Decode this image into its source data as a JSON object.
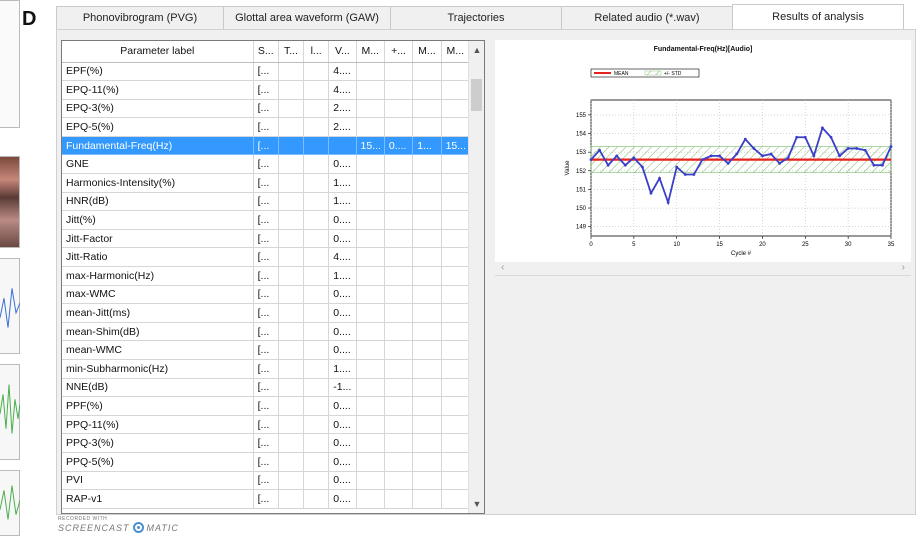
{
  "panel_label": "D",
  "tabs": [
    {
      "label": "Phonovibrogram (PVG)",
      "active": false
    },
    {
      "label": "Glottal area waveform (GAW)",
      "active": false
    },
    {
      "label": "Trajectories",
      "active": false
    },
    {
      "label": "Related audio (*.wav)",
      "active": false
    },
    {
      "label": "Results of analysis",
      "active": true
    }
  ],
  "table": {
    "columns": [
      "Parameter label",
      "S...",
      "T...",
      "l...",
      "V...",
      "M...",
      "+...",
      "M...",
      "M..."
    ],
    "rows": [
      [
        "EPF(%)",
        "[...",
        "",
        "",
        "4....",
        "",
        "",
        "",
        ""
      ],
      [
        "EPQ-11(%)",
        "[...",
        "",
        "",
        "4....",
        "",
        "",
        "",
        ""
      ],
      [
        "EPQ-3(%)",
        "[...",
        "",
        "",
        "2....",
        "",
        "",
        "",
        ""
      ],
      [
        "EPQ-5(%)",
        "[...",
        "",
        "",
        "2....",
        "",
        "",
        "",
        ""
      ],
      [
        "Fundamental-Freq(Hz)",
        "[...",
        "",
        "",
        "",
        "15...",
        "0....",
        "1...",
        "15..."
      ],
      [
        "GNE",
        "[...",
        "",
        "",
        "0....",
        "",
        "",
        "",
        ""
      ],
      [
        "Harmonics-Intensity(%)",
        "[...",
        "",
        "",
        "1....",
        "",
        "",
        "",
        ""
      ],
      [
        "HNR(dB)",
        "[...",
        "",
        "",
        "1....",
        "",
        "",
        "",
        ""
      ],
      [
        "Jitt(%)",
        "[...",
        "",
        "",
        "0....",
        "",
        "",
        "",
        ""
      ],
      [
        "Jitt-Factor",
        "[...",
        "",
        "",
        "0....",
        "",
        "",
        "",
        ""
      ],
      [
        "Jitt-Ratio",
        "[...",
        "",
        "",
        "4....",
        "",
        "",
        "",
        ""
      ],
      [
        "max-Harmonic(Hz)",
        "[...",
        "",
        "",
        "1....",
        "",
        "",
        "",
        ""
      ],
      [
        "max-WMC",
        "[...",
        "",
        "",
        "0....",
        "",
        "",
        "",
        ""
      ],
      [
        "mean-Jitt(ms)",
        "[...",
        "",
        "",
        "0....",
        "",
        "",
        "",
        ""
      ],
      [
        "mean-Shim(dB)",
        "[...",
        "",
        "",
        "0....",
        "",
        "",
        "",
        ""
      ],
      [
        "mean-WMC",
        "[...",
        "",
        "",
        "0....",
        "",
        "",
        "",
        ""
      ],
      [
        "min-Subharmonic(Hz)",
        "[...",
        "",
        "",
        "1....",
        "",
        "",
        "",
        ""
      ],
      [
        "NNE(dB)",
        "[...",
        "",
        "",
        "-1...",
        "",
        "",
        "",
        ""
      ],
      [
        "PPF(%)",
        "[...",
        "",
        "",
        "0....",
        "",
        "",
        "",
        ""
      ],
      [
        "PPQ-11(%)",
        "[...",
        "",
        "",
        "0....",
        "",
        "",
        "",
        ""
      ],
      [
        "PPQ-3(%)",
        "[...",
        "",
        "",
        "0....",
        "",
        "",
        "",
        ""
      ],
      [
        "PPQ-5(%)",
        "[...",
        "",
        "",
        "0....",
        "",
        "",
        "",
        ""
      ],
      [
        "PVI",
        "[...",
        "",
        "",
        "0....",
        "",
        "",
        "",
        ""
      ],
      [
        "RAP-v1",
        "[...",
        "",
        "",
        "0....",
        "",
        "",
        "",
        ""
      ]
    ],
    "selected_row": 4
  },
  "colors": {
    "selection": "#3399ff",
    "mean_line": "#e8221c",
    "series_line": "#3a3fc8",
    "std_band": "#7dbb6a"
  },
  "chart_data": {
    "type": "line",
    "title": "Fundamental-Freq(Hz)[Audio]",
    "xlabel": "Cycle #",
    "ylabel": "Value",
    "xlim": [
      0,
      35
    ],
    "ylim": [
      148.5,
      155.8
    ],
    "xticks": [
      0,
      5,
      10,
      15,
      20,
      25,
      30,
      35
    ],
    "yticks": [
      149,
      150,
      151,
      152,
      153,
      154,
      155
    ],
    "grid": true,
    "legend": [
      {
        "name": "MEAN",
        "kind": "line"
      },
      {
        "name": "+/- STD",
        "kind": "band"
      }
    ],
    "mean": 152.6,
    "std_band": [
      151.9,
      153.3
    ],
    "series": [
      {
        "name": "",
        "x": [
          0,
          1,
          2,
          3,
          4,
          5,
          6,
          7,
          8,
          9,
          10,
          11,
          12,
          13,
          14,
          15,
          16,
          17,
          18,
          19,
          20,
          21,
          22,
          23,
          24,
          25,
          26,
          27,
          28,
          29,
          30,
          31,
          32,
          33,
          34,
          35
        ],
        "values": [
          152.6,
          153.1,
          152.3,
          152.8,
          152.3,
          152.7,
          152.2,
          150.8,
          151.6,
          150.3,
          152.2,
          151.8,
          151.8,
          152.6,
          152.8,
          152.8,
          152.4,
          152.9,
          153.7,
          153.2,
          152.8,
          152.9,
          152.4,
          152.7,
          153.8,
          153.8,
          152.8,
          154.3,
          153.8,
          152.8,
          153.2,
          153.2,
          153.1,
          152.3,
          152.3,
          153.3
        ]
      }
    ]
  }
}
